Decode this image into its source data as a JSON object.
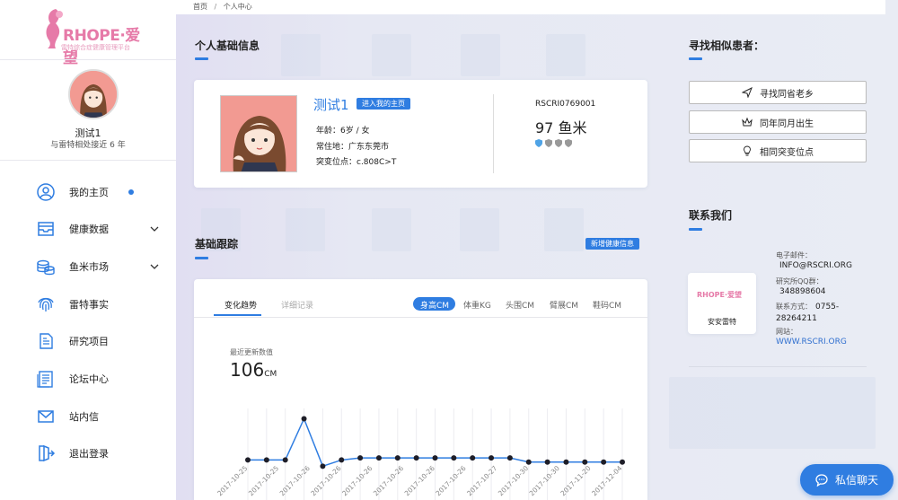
{
  "logo": {
    "text": "RHOPE·爱望",
    "sub": "雷特综合症健康管理平台"
  },
  "user": {
    "name": "测试1",
    "since": "与雷特相处接近 6 年"
  },
  "menu": [
    {
      "label": "我的主页",
      "icon": "user-circle-icon",
      "dot": true,
      "chevron": false
    },
    {
      "label": "健康数据",
      "icon": "inbox-icon",
      "dot": false,
      "chevron": true
    },
    {
      "label": "鱼米市场",
      "icon": "coins-icon",
      "dot": false,
      "chevron": true
    },
    {
      "label": "雷特事实",
      "icon": "fingerprint-icon",
      "dot": false,
      "chevron": false
    },
    {
      "label": "研究项目",
      "icon": "document-icon",
      "dot": false,
      "chevron": false
    },
    {
      "label": "论坛中心",
      "icon": "forum-icon",
      "dot": false,
      "chevron": false
    },
    {
      "label": "站内信",
      "icon": "mail-icon",
      "dot": false,
      "chevron": false
    },
    {
      "label": "退出登录",
      "icon": "logout-icon",
      "dot": false,
      "chevron": false
    }
  ],
  "breadcrumb": {
    "home": "首页",
    "sep": "/",
    "current": "个人中心"
  },
  "profile": {
    "section_title": "个人基础信息",
    "name": "测试1",
    "enter_label": "进入我的主页",
    "age": "年龄：6岁 / 女",
    "location": "常住地：广东东莞市",
    "mutation": "突变位点：c.808C>T",
    "code": "RSCRI0769001",
    "points": "97 鱼米"
  },
  "similar": {
    "title": "寻找相似患者：",
    "buttons": [
      {
        "label": "寻找同省老乡",
        "icon": "send-icon"
      },
      {
        "label": "同年同月出生",
        "icon": "crown-icon"
      },
      {
        "label": "相同突变位点",
        "icon": "lightbulb-icon"
      }
    ]
  },
  "contact": {
    "title": "联系我们",
    "org": "安安雷特",
    "org_logo_text": "RHOPE·爱望",
    "email_label": "电子邮件：",
    "email": "INFO@RSCRI.ORG",
    "qq_label": "研究所QQ群：",
    "qq": "348898604",
    "phone_label": "联系方式：",
    "phone": "0755-28264211",
    "web_label": "网站：",
    "web": "WWW.RSCRI.ORG"
  },
  "tracking": {
    "title": "基础跟踪",
    "add_label": "新增健康信息",
    "tabs": [
      "变化趋势",
      "详细记录"
    ],
    "metrics": [
      "身高CM",
      "体重KG",
      "头围CM",
      "臂展CM",
      "鞋码CM"
    ],
    "latest_label": "最近更新数值",
    "latest_value": "106",
    "latest_unit": "CM"
  },
  "chat": {
    "label": "私信聊天"
  },
  "colors": {
    "accent": "#2f7de1",
    "logo_pink": "#e67aa8"
  },
  "chart_data": {
    "type": "line",
    "x": [
      "2017-10-25",
      "2017-10-25",
      "2017-10-25",
      "2017-10-26",
      "2017-10-26",
      "2017-10-26",
      "2017-10-26",
      "2017-10-26",
      "2017-10-26",
      "2017-10-26",
      "2017-10-26",
      "2017-10-26",
      "2017-10-26",
      "2017-10-26",
      "2017-10-27",
      "2017-10-30",
      "2017-10-30",
      "2017-10-30",
      "2017-11-20",
      "2017-12-04",
      "2017-12-04"
    ],
    "x_tick_labels": [
      "2017-10-25",
      "2017-10-25",
      "2017-10-26",
      "2017-10-26",
      "2017-10-26",
      "2017-10-26",
      "2017-10-26",
      "2017-10-26",
      "2017-10-27",
      "2017-10-30",
      "2017-10-30",
      "2017-11-20",
      "2017-12-04"
    ],
    "series": [
      {
        "values": [
          100,
          100,
          100,
          120,
          97,
          100,
          101,
          101,
          101,
          101,
          101,
          101,
          101,
          101,
          101,
          99,
          99,
          99,
          99,
          99,
          99
        ]
      }
    ],
    "ylim": [
      88,
      125
    ]
  }
}
